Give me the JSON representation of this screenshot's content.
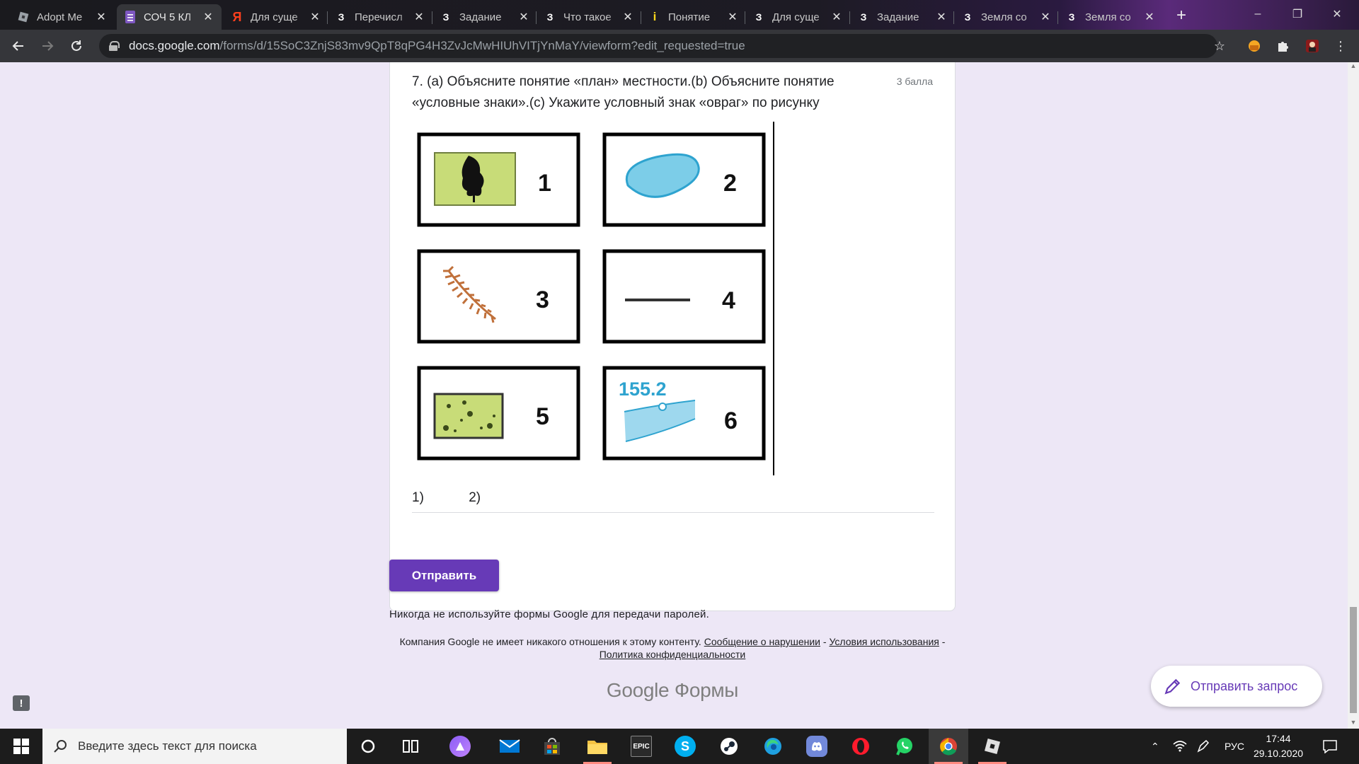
{
  "browser": {
    "tabs": [
      {
        "title": "Adopt Me",
        "favicon": "roblox-icon",
        "color": "#5f6368",
        "active": false
      },
      {
        "title": "СОЧ 5 КЛ",
        "favicon": "google-forms-icon",
        "color": "#7e57c2",
        "active": true
      },
      {
        "title": "Для суще",
        "favicon": "yandex-icon",
        "color": "#fc3f1d",
        "active": false
      },
      {
        "title": "Перечисл",
        "favicon": "znanija-icon",
        "color": "#000000",
        "active": false
      },
      {
        "title": "Задание",
        "favicon": "znanija-icon",
        "color": "#000000",
        "active": false
      },
      {
        "title": "Что такое",
        "favicon": "znanija-icon",
        "color": "#000000",
        "active": false
      },
      {
        "title": "Понятие",
        "favicon": "info-icon",
        "color": "#f9d71c",
        "active": false
      },
      {
        "title": "Для суще",
        "favicon": "znanija-icon",
        "color": "#000000",
        "active": false
      },
      {
        "title": "Задание",
        "favicon": "znanija-icon",
        "color": "#000000",
        "active": false
      },
      {
        "title": "Земля со",
        "favicon": "znanija-icon",
        "color": "#000000",
        "active": false
      },
      {
        "title": "Земля со",
        "favicon": "znanija-icon",
        "color": "#000000",
        "active": false
      }
    ],
    "favicon_letters": {
      "znanija": "З",
      "yandex": "Я",
      "info": "i"
    },
    "new_tab_label": "+",
    "window_controls": {
      "minimize": "–",
      "restore": "❐",
      "close": "✕"
    },
    "url_host": "docs.google.com",
    "url_path": "/forms/d/15SoC3ZnjS83mv9QpT8qPG4H3ZvJcMwHIUhVITjYnMaY/viewform?edit_requested=true"
  },
  "form": {
    "question_text": "7. (а) Объясните понятие «план» местности.(b) Объясните понятие «условные знаки».(с) Укажите условный знак «овраг» по рисунку",
    "points": "3 балла",
    "figure_items": [
      {
        "number": "1",
        "icon": "forest-sign-icon"
      },
      {
        "number": "2",
        "icon": "lake-sign-icon"
      },
      {
        "number": "3",
        "icon": "ravine-sign-icon"
      },
      {
        "number": "4",
        "icon": "road-line-sign-icon"
      },
      {
        "number": "5",
        "icon": "bush-sign-icon"
      },
      {
        "number": "6",
        "icon": "river-elevation-sign-icon"
      }
    ],
    "figure_elevation_label": "155.2",
    "answer_value": "1)            2)",
    "submit_label": "Отправить",
    "password_warning": "Никогда не используйте формы Google для передачи паролей.",
    "disclaimer_prefix": "Компания Google не имеет никакого отношения к этому контенту.",
    "link_report": "Сообщение о нарушении",
    "link_terms": "Условия использования",
    "link_privacy": "Политика конфиденциальности",
    "separator": " - ",
    "brand_google": "Google",
    "brand_forms": "Формы",
    "feedback_button": "Отправить запрос",
    "report_icon_glyph": "!"
  },
  "taskbar": {
    "search_placeholder": "Введите здесь текст для поиска",
    "language": "РУС",
    "time": "17:44",
    "date": "29.10.2020",
    "apps": [
      "cortana-icon",
      "task-view-icon",
      "alice-icon",
      "mail-icon",
      "store-icon",
      "file-explorer-icon",
      "epic-games-icon",
      "skype-icon",
      "steam-icon",
      "edge-icon",
      "discord-icon",
      "opera-icon",
      "whatsapp-icon",
      "chrome-icon",
      "roblox-studio-icon"
    ],
    "epic_label": "EPIC"
  },
  "colors": {
    "accent": "#673ab7",
    "page_bg": "#ede7f6"
  }
}
